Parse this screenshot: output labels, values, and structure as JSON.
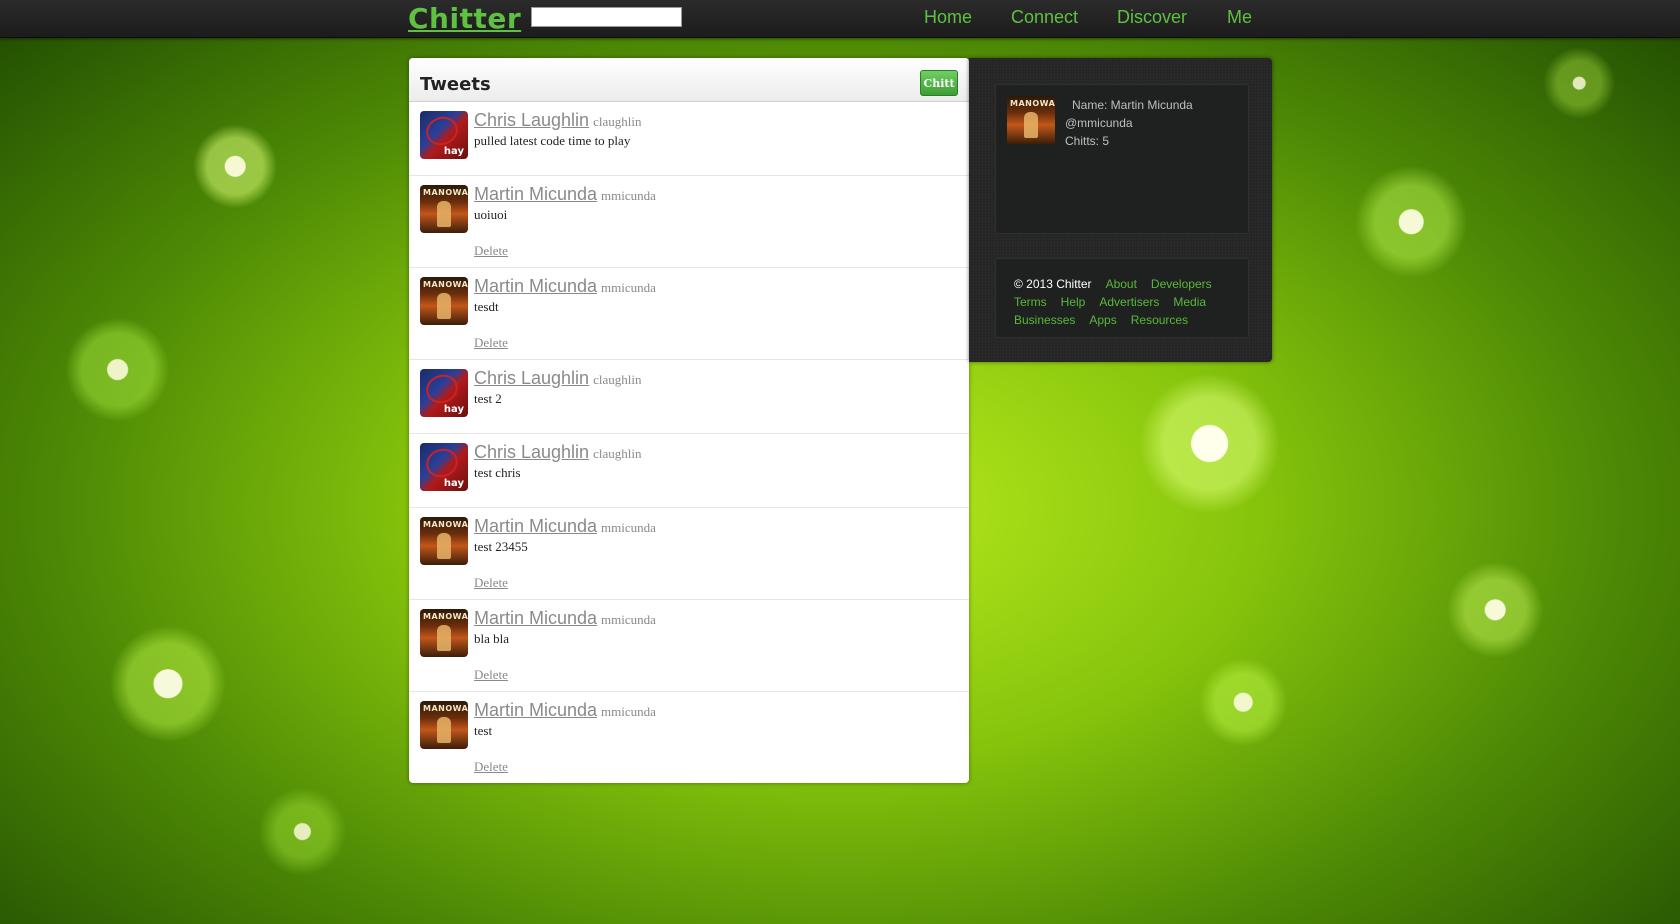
{
  "app": {
    "logo": "Chitter",
    "search": {
      "value": "",
      "placeholder": ""
    }
  },
  "nav": [
    {
      "label": "Home"
    },
    {
      "label": "Connect"
    },
    {
      "label": "Discover"
    },
    {
      "label": "Me"
    }
  ],
  "main": {
    "title": "Tweets",
    "post_button": "Chitt",
    "tweets": [
      {
        "name": "Chris Laughlin",
        "handle": "claughlin",
        "text": "pulled latest code time to play",
        "avatar": "spiderman-avatar",
        "delete": ""
      },
      {
        "name": "Martin Micunda",
        "handle": "mmicunda",
        "text": "uoiuoi",
        "avatar": "manowar-avatar",
        "delete": "Delete"
      },
      {
        "name": "Martin Micunda",
        "handle": "mmicunda",
        "text": "tesdt",
        "avatar": "manowar-avatar",
        "delete": "Delete"
      },
      {
        "name": "Chris Laughlin",
        "handle": "claughlin",
        "text": "test 2",
        "avatar": "spiderman-avatar",
        "delete": ""
      },
      {
        "name": "Chris Laughlin",
        "handle": "claughlin",
        "text": "test chris",
        "avatar": "spiderman-avatar",
        "delete": ""
      },
      {
        "name": "Martin Micunda",
        "handle": "mmicunda",
        "text": "test 23455",
        "avatar": "manowar-avatar",
        "delete": "Delete"
      },
      {
        "name": "Martin Micunda",
        "handle": "mmicunda",
        "text": "bla bla",
        "avatar": "manowar-avatar",
        "delete": "Delete"
      },
      {
        "name": "Martin Micunda",
        "handle": "mmicunda",
        "text": "test",
        "avatar": "manowar-avatar",
        "delete": "Delete"
      }
    ]
  },
  "profile": {
    "name": "Name: Martin Micunda",
    "handle": "@mmicunda",
    "chitts": "Chitts: 5"
  },
  "footer": {
    "copyright": "© 2013 Chitter",
    "links": [
      "About",
      "Developers",
      "Terms",
      "Help",
      "Advertisers",
      "Media",
      "Businesses",
      "Apps",
      "Resources"
    ]
  },
  "colors": {
    "accent": "#5fc141",
    "topbar": "#222222",
    "sidebar": "#252525"
  }
}
